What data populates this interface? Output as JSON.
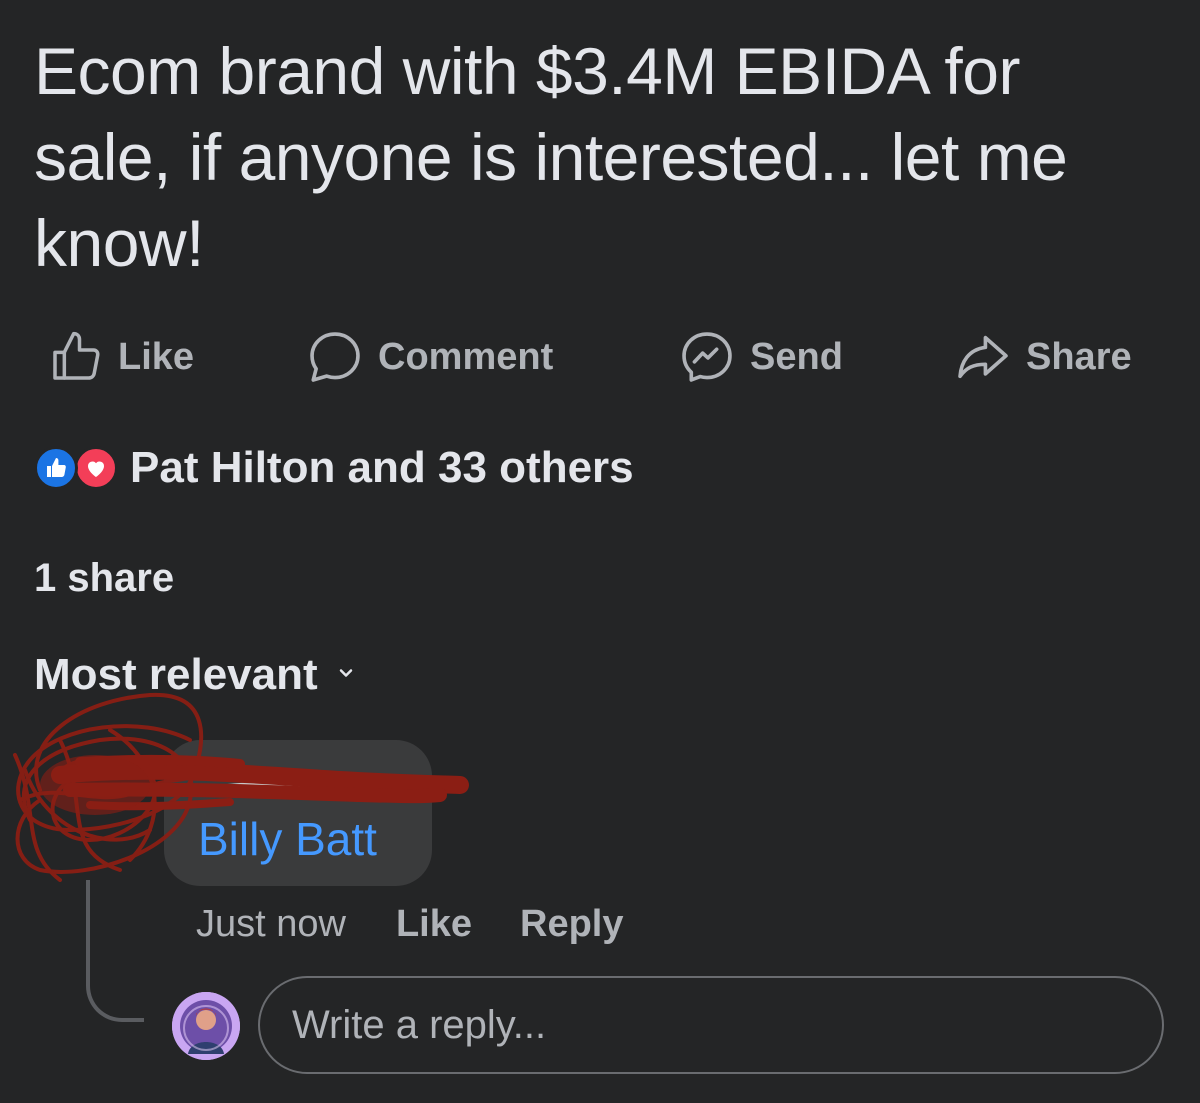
{
  "post": {
    "text": "Ecom brand with $3.4M EBIDA for sale, if anyone is interested... let me know!"
  },
  "actions": {
    "like": "Like",
    "comment": "Comment",
    "send": "Send",
    "share": "Share"
  },
  "reactions": {
    "summary": "Pat Hilton and 33 others",
    "icons": [
      "like-icon",
      "love-icon"
    ]
  },
  "shares": "1 share",
  "comments": {
    "sort_label": "Most relevant",
    "items": [
      {
        "mention": "Billy Batt",
        "time": "Just now",
        "like_label": "Like",
        "reply_label": "Reply"
      }
    ]
  },
  "reply_box": {
    "placeholder": "Write a reply..."
  },
  "colors": {
    "background": "#242526",
    "text_primary": "#e4e6eb",
    "text_secondary": "#b0b3b8",
    "mention": "#4599ff",
    "like_blue": "#1b74e4",
    "love_red": "#f33e58",
    "scribble_red": "#8b1e14"
  }
}
